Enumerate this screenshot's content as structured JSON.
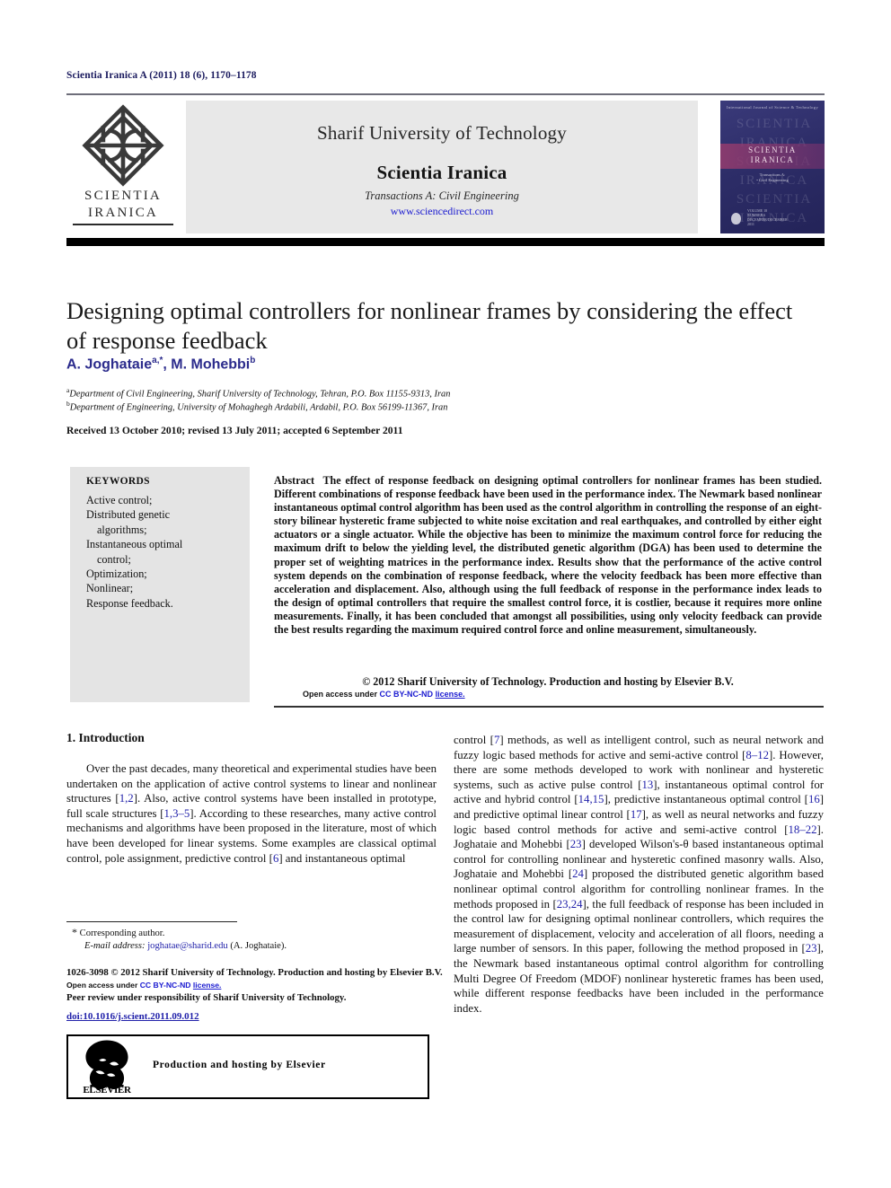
{
  "running_head": "Scientia Iranica A (2011) 18 (6), 1170–1178",
  "banner": {
    "logo_line1": "SCIENTIA",
    "logo_line2": "IRANICA",
    "university": "Sharif University of Technology",
    "journal": "Scientia Iranica",
    "transactions": "Transactions A: Civil Engineering",
    "url": "www.sciencedirect.com",
    "cover": {
      "top_line": "International Journal of Science & Technology",
      "ghost_text": "SCIENTIA\nIRANICA\nSCIENTIA\nIRANICA\nSCIENTIA\nIRANICA",
      "band_line1": "SCIENTIA",
      "band_line2": "IRANICA",
      "subtitle": "Transactions A:\n• Civil Engineering",
      "footer": "VOLUME 18\nNUMBER 6\nDECEMBER/DECEMBER\n2011"
    }
  },
  "article": {
    "title": "Designing optimal controllers for nonlinear frames by considering the effect of response feedback",
    "authors_plain": "A. Joghataie a,*, M. Mohebbi b",
    "author1": "A. Joghataie",
    "author1_sup": "a,*",
    "author2": "M. Mohebbi",
    "author2_sup": "b",
    "affiliation_a_sup": "a",
    "affiliation_a": "Department of Civil Engineering, Sharif University of Technology, Tehran, P.O. Box 11155-9313, Iran",
    "affiliation_b_sup": "b",
    "affiliation_b": "Department of Engineering, University of Mohaghegh Ardabili, Ardabil, P.O. Box 56199-11367, Iran",
    "history": "Received 13 October 2010; revised 13 July 2011; accepted 6 September 2011"
  },
  "keywords": {
    "heading": "KEYWORDS",
    "items": [
      {
        "text": "Active control;",
        "continuation": false
      },
      {
        "text": "Distributed genetic",
        "continuation": false
      },
      {
        "text": "algorithms;",
        "continuation": true
      },
      {
        "text": "Instantaneous optimal",
        "continuation": false
      },
      {
        "text": "control;",
        "continuation": true
      },
      {
        "text": "Optimization;",
        "continuation": false
      },
      {
        "text": "Nonlinear;",
        "continuation": false
      },
      {
        "text": "Response feedback.",
        "continuation": false
      }
    ]
  },
  "abstract": {
    "label": "Abstract",
    "text": "The effect of response feedback on designing optimal controllers for nonlinear frames has been studied. Different combinations of response feedback have been used in the performance index. The Newmark based nonlinear instantaneous optimal control algorithm has been used as the control algorithm in controlling the response of an eight-story bilinear hysteretic frame subjected to white noise excitation and real earthquakes, and controlled by either eight actuators or a single actuator. While the objective has been to minimize the maximum control force for reducing the maximum drift to below the yielding level, the distributed genetic algorithm (DGA) has been used to determine the proper set of weighting matrices in the performance index. Results show that the performance of the active control system depends on the combination of response feedback, where the velocity feedback has been more effective than acceleration and displacement. Also, although using the full feedback of response in the performance index leads to the design of optimal controllers that require the smallest control force, it is costlier, because it requires more online measurements. Finally, it has been concluded that amongst all possibilities, using only velocity feedback can provide the best results regarding the maximum required control force and online measurement, simultaneously.",
    "copyright": "© 2012 Sharif University of Technology. Production and hosting by Elsevier B.V.",
    "open_access_prefix": "Open access under ",
    "open_access_link": "CC BY-NC-ND",
    "open_access_suffix": "license."
  },
  "body": {
    "section_heading": "1. Introduction",
    "left_column_paragraph": "Over the past decades, many theoretical and experimental studies have been undertaken on the application of active control systems to linear and nonlinear structures [1,2]. Also, active control systems have been installed in prototype, full scale structures [1,3–5]. According to these researches, many active control mechanisms and algorithms have been proposed in the literature, most of which have been developed for linear systems. Some examples are classical optimal control, pole assignment, predictive control [6] and instantaneous optimal",
    "right_column_paragraph": "control [7] methods, as well as intelligent control, such as neural network and fuzzy logic based methods for active and semi-active control [8–12]. However, there are some methods developed to work with nonlinear and hysteretic systems, such as active pulse control [13], instantaneous optimal control for active and hybrid control [14,15], predictive instantaneous optimal control [16] and predictive optimal linear control [17], as well as neural networks and fuzzy logic based control methods for active and semi-active control [18–22]. Joghataie and Mohebbi [23] developed Wilson's-θ based instantaneous optimal control for controlling nonlinear and hysteretic confined masonry walls. Also, Joghataie and Mohebbi [24] proposed the distributed genetic algorithm based nonlinear optimal control algorithm for controlling nonlinear frames. In the methods proposed in [23,24], the full feedback of response has been included in the control law for designing optimal nonlinear controllers, which requires the measurement of displacement, velocity and acceleration of all floors, needing a large number of sensors. In this paper, following the method proposed in [23], the Newmark based instantaneous optimal control algorithm for controlling Multi Degree Of Freedom (MDOF) nonlinear hysteretic frames has been used, while different response feedbacks have been included in the performance index."
  },
  "footnotes": {
    "corresponding_star": "*",
    "corresponding_text": "Corresponding author.",
    "email_label": "E-mail address:",
    "email": "joghatae@sharid.edu",
    "email_person": "(A. Joghataie).",
    "issn_line": "1026-3098 © 2012 Sharif University of Technology. Production and hosting by Elsevier B.V.",
    "open_access_prefix": "Open access under ",
    "open_access_link": "CC BY-NC-ND",
    "open_access_suffix": "license.",
    "peer_review": "Peer review under responsibility of Sharif  University of Technology.",
    "doi": "doi:10.1016/j.scient.2011.09.012",
    "elsevier_box_text": "Production and hosting by Elsevier",
    "elsevier_wordmark": "ELSEVIER"
  },
  "colors": {
    "link": "#1a1ad0",
    "author": "#2b2b8c",
    "reference": "#2222aa",
    "running_head": "#1a1a5e",
    "banner_bg": "#e8e8e8",
    "keyword_bg": "#e4e4e4",
    "cover_bg": "#2a2a66"
  }
}
